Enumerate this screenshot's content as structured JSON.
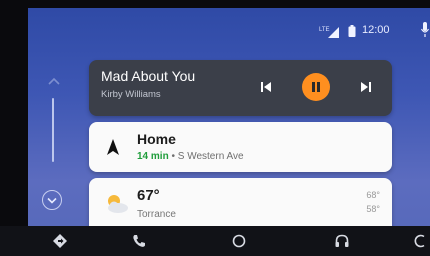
{
  "status": {
    "time": "12:00",
    "icons": [
      "signal-icon",
      "battery-icon",
      "mic-icon"
    ]
  },
  "rail": {
    "icons": [
      "chevron-up-icon",
      "chevron-down-icon"
    ]
  },
  "media": {
    "title": "Mad About You",
    "artist": "Kirby Williams",
    "accent": "#ff8f1f",
    "icons": [
      "skip-previous-icon",
      "pause-icon",
      "skip-next-icon"
    ]
  },
  "navigation": {
    "destination": "Home",
    "eta": "14 min",
    "separator": " • ",
    "street": "S Western Ave",
    "eta_color": "#1f9d3b",
    "icon": "navigation-arrow-icon"
  },
  "weather": {
    "temperature": "67°",
    "location": "Torrance",
    "high": "68°",
    "low": "58°",
    "icon": "partly-cloudy-icon"
  },
  "bottom_nav": {
    "icons": [
      "directions-icon",
      "phone-icon",
      "home-circle-icon",
      "headphones-icon",
      "exit-icon"
    ]
  }
}
